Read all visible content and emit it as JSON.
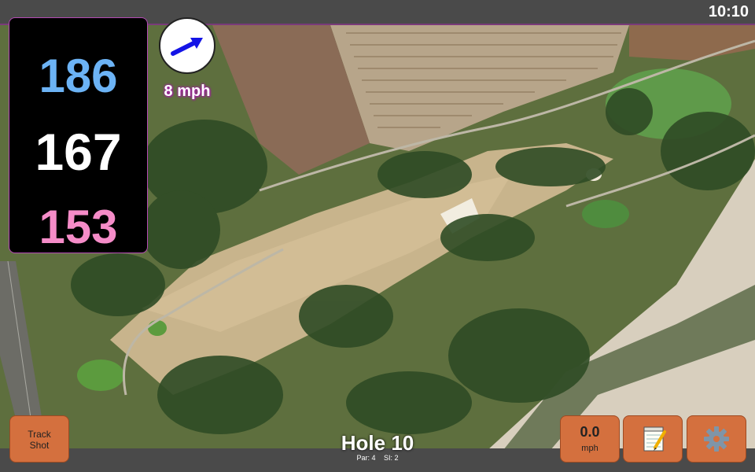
{
  "status": {
    "clock": "10:10"
  },
  "yardages": {
    "back": "186",
    "middle": "167",
    "front": "153"
  },
  "wind": {
    "speed": "8 mph",
    "icon": "wind-direction-arrow-icon"
  },
  "buttons": {
    "track_shot": [
      "Track",
      "Shot"
    ],
    "speed": {
      "value": "0.0",
      "unit": "mph"
    },
    "notes_icon": "notepad-icon",
    "settings_icon": "gear-icon"
  },
  "hole": {
    "title": "Hole 10",
    "par": "Par: 4",
    "si": "SI: 2"
  },
  "colors": {
    "back_yardage": "#6cb3f5",
    "middle_yardage": "#ffffff",
    "front_yardage": "#f58cc8",
    "button": "#d4703e",
    "panel_border": "#b44ab4"
  }
}
